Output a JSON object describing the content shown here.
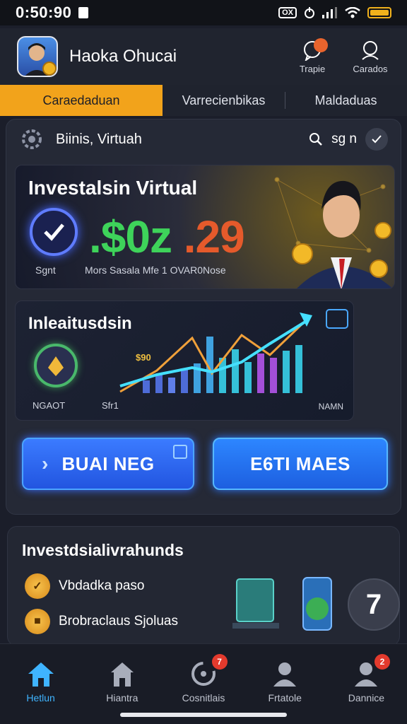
{
  "status_bar": {
    "time": "0:50:90",
    "badge": "OX",
    "colors": {
      "battery": "#f1b21c"
    }
  },
  "header": {
    "app_title": "Haoka Ohucai",
    "actions": [
      {
        "label": "Trapie",
        "icon": "chat-bubble-icon"
      },
      {
        "label": "Carados",
        "icon": "profile-icon"
      }
    ]
  },
  "tabs": [
    {
      "label": "Caraedaduan",
      "active": true
    },
    {
      "label": "Varrecienbikas",
      "active": false
    },
    {
      "label": "Maldaduas",
      "active": false
    }
  ],
  "main_card": {
    "title": "Biinis, Virtuah",
    "search_text": "sg n",
    "banner": {
      "title": "Investalsin Virtual",
      "amount_part1": ".$0z",
      "amount_part2": " .29",
      "ring_label": "Sgnt",
      "subtitle": "Mors Sasala Mfe 1 OVAR0Nose"
    },
    "chart_card": {
      "title": "Inleaitusdsin",
      "value_label": "$90",
      "left_label": "NGAOT",
      "mid_label": "Sfr1",
      "right_label": "NAMN"
    },
    "buttons": [
      {
        "label": "BUAI NEG"
      },
      {
        "label": "E6TI MAES"
      }
    ]
  },
  "lower_card": {
    "title": "Investdsialivrahunds",
    "items": [
      {
        "label": "Vbdadka paso"
      },
      {
        "label": "Brobraclaus Sjoluas"
      }
    ],
    "fab_label": "7"
  },
  "bottom_nav": [
    {
      "label": "Hetlun",
      "icon": "home-icon",
      "active": true,
      "badge": ""
    },
    {
      "label": "Hiantra",
      "icon": "building-icon",
      "active": false,
      "badge": ""
    },
    {
      "label": "Cosnitlais",
      "icon": "refresh-icon",
      "active": false,
      "badge": "7"
    },
    {
      "label": "Frtatole",
      "icon": "user-icon",
      "active": false,
      "badge": ""
    },
    {
      "label": "Dannice",
      "icon": "user-icon",
      "active": false,
      "badge": "2"
    }
  ]
}
